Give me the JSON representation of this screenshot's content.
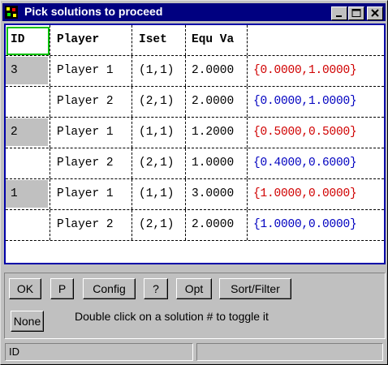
{
  "window": {
    "title": "Pick solutions to proceed"
  },
  "grid": {
    "headers": [
      "ID",
      "Player",
      "Iset",
      "Equ Va",
      ""
    ],
    "rows": [
      {
        "id": "3",
        "player": "Player 1",
        "iset": "(1,1)",
        "equ": "2.0000",
        "profile": "{0.0000,1.0000}"
      },
      {
        "id": "",
        "player": "Player 2",
        "iset": "(2,1)",
        "equ": "2.0000",
        "profile": "{0.0000,1.0000}"
      },
      {
        "id": "2",
        "player": "Player 1",
        "iset": "(1,1)",
        "equ": "1.2000",
        "profile": "{0.5000,0.5000}"
      },
      {
        "id": "",
        "player": "Player 2",
        "iset": "(2,1)",
        "equ": "1.0000",
        "profile": "{0.4000,0.6000}"
      },
      {
        "id": "1",
        "player": "Player 1",
        "iset": "(1,1)",
        "equ": "3.0000",
        "profile": "{1.0000,0.0000}"
      },
      {
        "id": "",
        "player": "Player 2",
        "iset": "(2,1)",
        "equ": "2.0000",
        "profile": "{1.0000,0.0000}"
      }
    ]
  },
  "buttons": {
    "ok": "OK",
    "p": "P",
    "config": "Config",
    "help": "?",
    "opt": "Opt",
    "sort": "Sort/Filter",
    "none": "None"
  },
  "hint": "Double click on a solution # to toggle it",
  "statusbar": {
    "left": "ID",
    "right": ""
  },
  "colors": {
    "title_bar": "#000080",
    "player1_profile": "#d00000",
    "player2_profile": "#0000c0",
    "focus": "#00c000"
  }
}
